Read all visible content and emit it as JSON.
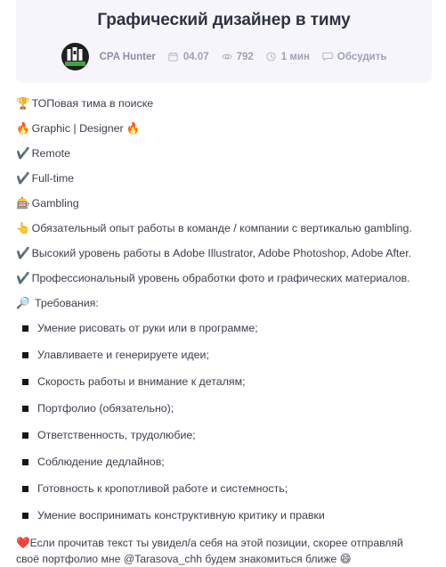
{
  "post": {
    "title": "Графический дизайнер в тиму",
    "author": "CPA Hunter",
    "meta": {
      "date": "04.07",
      "views": "792",
      "read_time": "1 мин",
      "comments_label": "Обсудить"
    },
    "icons": {
      "avatar": "cpa-hunter-avatar",
      "date": "calendar-icon",
      "views": "eye-icon",
      "time": "clock-icon",
      "comments": "comment-icon"
    },
    "intro_lines": [
      {
        "emoji": "🏆",
        "emoji_name": "trophy-emoji",
        "text": "ТОПовая тима в поиске",
        "trailing_emoji": "",
        "trailing_emoji_name": ""
      },
      {
        "emoji": "🔥",
        "emoji_name": "fire-emoji",
        "text": "Graphic | Designer",
        "trailing_emoji": "🔥",
        "trailing_emoji_name": "fire-emoji"
      },
      {
        "emoji": "✔️",
        "emoji_name": "check-mark-emoji",
        "text": "Remote",
        "trailing_emoji": "",
        "trailing_emoji_name": ""
      },
      {
        "emoji": "✔️",
        "emoji_name": "check-mark-emoji",
        "text": "Full-time",
        "trailing_emoji": "",
        "trailing_emoji_name": ""
      },
      {
        "emoji": "🎰",
        "emoji_name": "slot-machine-emoji",
        "text": "Gambling",
        "trailing_emoji": "",
        "trailing_emoji_name": ""
      },
      {
        "emoji": "👆",
        "emoji_name": "pointing-up-emoji",
        "text": "Обязательный опыт работы в команде / компании с вертикалью gambling.",
        "trailing_emoji": "",
        "trailing_emoji_name": ""
      },
      {
        "emoji": "✔️",
        "emoji_name": "check-mark-emoji",
        "text": "Высокий уровень работы в Adobe Illustrator, Adobe Photoshop, Adobe After.",
        "trailing_emoji": "",
        "trailing_emoji_name": ""
      },
      {
        "emoji": "✔️",
        "emoji_name": "check-mark-emoji",
        "text": "Профессиональный уровень обработки фото и графических материалов.",
        "trailing_emoji": "",
        "trailing_emoji_name": ""
      },
      {
        "emoji": "🔎",
        "emoji_name": "magnifying-glass-emoji",
        "text": "Требования:",
        "trailing_emoji": "",
        "trailing_emoji_name": ""
      }
    ],
    "requirements": [
      "Умение рисовать от руки или в программе;",
      "Улавливаете и генерируете идеи;",
      "Скорость работы и внимание к деталям;",
      "Портфолио (обязательно);",
      "Ответственность, трудолюбие;",
      "Соблюдение дедлайнов;",
      "Готовность к кропотливой работе и системность;",
      "Умение воспринимать конструктивную критику и правки"
    ],
    "outro": {
      "heart": "❤️",
      "text_before_handle": "Если прочитав текст ты увидел/а себя на этой позиции, скорее  отправляй своё портфолио мне  ",
      "handle": "@Tarasova_chh",
      "text_after_handle": " будем знакомиться ближе ",
      "smile": "😄"
    }
  },
  "colors": {
    "header_bg": "#f6f5fb",
    "title": "#2f3244",
    "meta_text": "#9ea2b3",
    "body_text": "#3b3f4d",
    "bullet": "#15171c",
    "heart": "#e8413c",
    "avatar_bg": "#1d1f21",
    "avatar_banner": "#3fa53f"
  }
}
